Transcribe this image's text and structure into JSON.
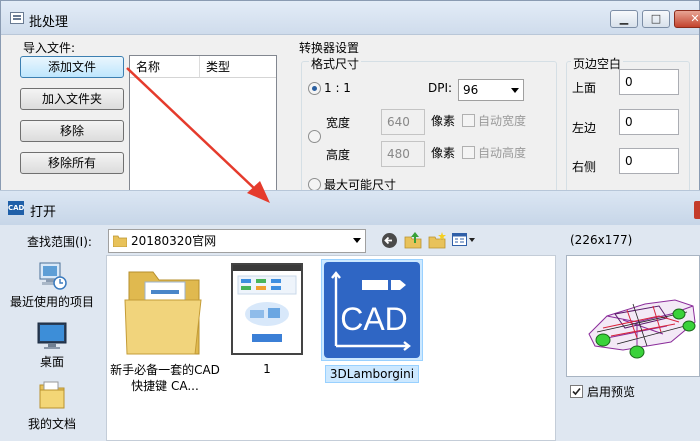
{
  "batch_window": {
    "title": "批处理",
    "caption_buttons": {
      "minimize": "▁",
      "maximize": "□",
      "close": "✕"
    },
    "import": {
      "label": "导入文件:",
      "add_file": "添加文件",
      "add_folder": "加入文件夹",
      "remove": "移除",
      "remove_all": "移除所有",
      "columns": [
        "名称",
        "类型"
      ]
    },
    "converter": {
      "label": "转换器设置",
      "format_size": {
        "label": "格式尺寸",
        "ratio": "1 : 1",
        "dpi_label": "DPI:",
        "dpi_value": "96",
        "width_label": "宽度",
        "width_value": "640",
        "height_label": "高度",
        "height_value": "480",
        "pixel_label": "像素",
        "auto_width": "自动宽度",
        "auto_height": "自动高度",
        "max_size": "最大可能尺寸"
      }
    },
    "margins": {
      "label": "页边空白",
      "top_label": "上面",
      "top_value": "0",
      "left_label": "左边",
      "left_value": "0",
      "right_label": "右侧",
      "right_value": "0"
    }
  },
  "open_dialog": {
    "icon_text": "CAD",
    "title": "打开",
    "lookin_label": "查找范围(I):",
    "lookin_value": "20180320官网",
    "places": [
      {
        "label": "最近使用的项目",
        "icon": "recent-places-icon"
      },
      {
        "label": "桌面",
        "icon": "desktop-icon"
      },
      {
        "label": "我的文档",
        "icon": "documents-icon"
      }
    ],
    "files": [
      {
        "name": "新手必备一套的CAD快捷键 CA...",
        "icon": "folder-icon"
      },
      {
        "name": "1",
        "icon": "screenshot-thumbnail-icon"
      },
      {
        "name": "3DLamborgini",
        "icon": "cad-file-icon",
        "thumb_text": "CAD"
      }
    ],
    "preview_size": "(226x177)",
    "enable_preview": "启用预览"
  },
  "colors": {
    "annotation_arrow": "#e53b2c",
    "cad_blue": "#2f66c4",
    "selection": "#cce8ff"
  }
}
